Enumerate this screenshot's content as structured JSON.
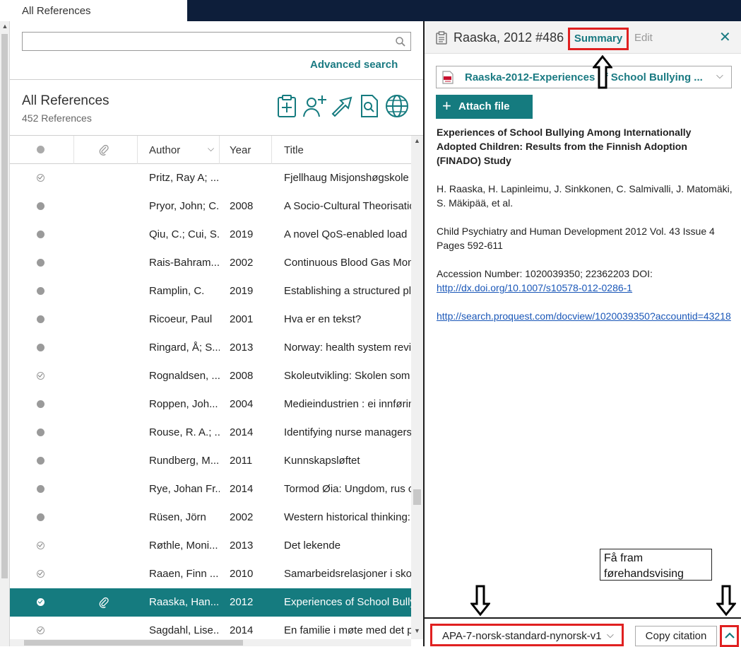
{
  "tab": {
    "label": "All References"
  },
  "search": {
    "placeholder": "",
    "advanced_label": "Advanced search"
  },
  "library": {
    "title": "All References",
    "count": "452 References"
  },
  "toolbar_icons": [
    "add-reference-icon",
    "add-user-icon",
    "export-icon",
    "find-fulltext-icon",
    "online-search-icon"
  ],
  "columns": {
    "author": "Author",
    "year": "Year",
    "title": "Title"
  },
  "rows": [
    {
      "status": "read",
      "attach": false,
      "author": "Pritz, Ray A; ...",
      "year": "",
      "title": "Fjellhaug Misjonshøgskole"
    },
    {
      "status": "unread",
      "attach": false,
      "author": "Pryor, John; C...",
      "year": "2008",
      "title": "A Socio-Cultural Theorisatio"
    },
    {
      "status": "unread",
      "attach": false,
      "author": "Qiu, C.; Cui, S...",
      "year": "2019",
      "title": "A novel QoS-enabled load"
    },
    {
      "status": "unread",
      "attach": false,
      "author": "Rais-Bahram...",
      "year": "2002",
      "title": "Continuous Blood Gas Mon"
    },
    {
      "status": "unread",
      "attach": false,
      "author": "Ramplin, C.",
      "year": "2019",
      "title": "Establishing a structured pl"
    },
    {
      "status": "unread",
      "attach": false,
      "author": "Ricoeur, Paul",
      "year": "2001",
      "title": "Hva er en tekst?"
    },
    {
      "status": "unread",
      "attach": false,
      "author": "Ringard, Å; S...",
      "year": "2013",
      "title": "Norway: health system revie"
    },
    {
      "status": "read",
      "attach": false,
      "author": "Rognaldsen, ...",
      "year": "2008",
      "title": "Skoleutvikling: Skolen som"
    },
    {
      "status": "unread",
      "attach": false,
      "author": "Roppen, Joh...",
      "year": "2004",
      "title": "Medieindustrien : ei innførin"
    },
    {
      "status": "unread",
      "attach": false,
      "author": "Rouse, R. A.; ...",
      "year": "2014",
      "title": "Identifying nurse managers"
    },
    {
      "status": "unread",
      "attach": false,
      "author": "Rundberg, M...",
      "year": "2011",
      "title": "Kunnskapsløftet"
    },
    {
      "status": "unread",
      "attach": false,
      "author": "Rye, Johan Fr...",
      "year": "2014",
      "title": "Tormod Øia: Ungdom, rus c"
    },
    {
      "status": "unread",
      "attach": false,
      "author": "Rüsen, Jörn",
      "year": "2002",
      "title": "Western historical thinking:"
    },
    {
      "status": "read",
      "attach": false,
      "author": "Røthle, Moni...",
      "year": "2013",
      "title": "Det lekende"
    },
    {
      "status": "read",
      "attach": false,
      "author": "Raaen, Finn ...",
      "year": "2010",
      "title": "Samarbeidsrelasjoner i skol"
    },
    {
      "status": "read",
      "attach": true,
      "selected": true,
      "author": "Raaska, Han...",
      "year": "2012",
      "title": "Experiences of School Bully"
    },
    {
      "status": "read",
      "attach": false,
      "author": "Sagdahl, Lise...",
      "year": "2014",
      "title": "En familie i møte med det p"
    }
  ],
  "panel": {
    "title": "Raaska, 2012 #486",
    "summary_tab": "Summary",
    "edit_tab": "Edit",
    "file_name": "Raaska-2012-Experiences of School Bullying ...",
    "attach_label": "Attach file",
    "ref_title": "Experiences of School Bullying Among Internationally Adopted Children: Results from the Finnish Adoption (FINADO) Study",
    "ref_authors": "H. Raaska, H. Lapinleimu, J. Sinkkonen, C. Salmivalli, J. Matomäki, S. Mäkipää, et al.",
    "ref_journal": "Child Psychiatry and Human Development 2012 Vol. 43 Issue 4 Pages 592-611",
    "ref_accession": "Accession Number: 1020039350; 22362203 DOI:",
    "ref_doi": "http://dx.doi.org/10.1007/s10578-012-0286-1",
    "ref_url": "http://search.proquest.com/docview/1020039350?accountid=43218",
    "annotation": "Få fram førehandsvising",
    "citation_style": "APA-7-norsk-standard-nynorsk-v1",
    "copy_label": "Copy citation"
  },
  "colors": {
    "accent": "#157b7f",
    "link": "#1a57b8",
    "highlight": "#e02020",
    "topbar": "#0d1e3a"
  }
}
